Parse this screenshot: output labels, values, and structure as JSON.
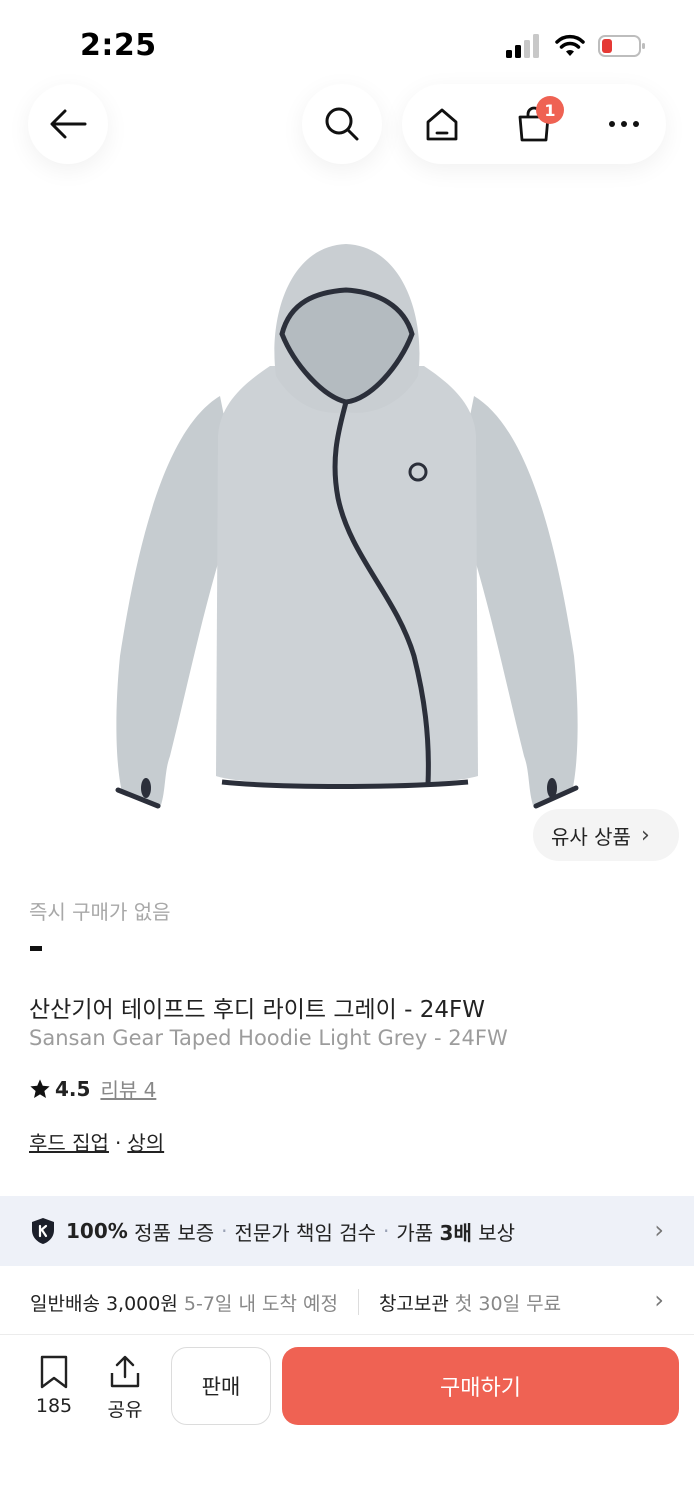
{
  "status_bar": {
    "time": "2:25",
    "icons": [
      "signal-icon",
      "wifi-icon",
      "battery-icon"
    ],
    "battery_color": "#e53935"
  },
  "nav": {
    "icons": [
      "back-arrow-icon",
      "search-icon",
      "home-icon",
      "cart-icon",
      "more-icon"
    ],
    "cart_count": "1"
  },
  "product": {
    "image": "hoodie-image",
    "similar_label": "유사 상품",
    "instant_status": "즉시 구매가 없음",
    "price": "-",
    "title_ko": "산산기어 테이프드 후디 라이트 그레이 - 24FW",
    "title_en": "Sansan Gear Taped Hoodie Light Grey - 24FW",
    "rating": "4.5",
    "review_label": "리뷰 4",
    "categories": [
      "후드 집업",
      "상의"
    ],
    "category_separator": "·"
  },
  "guarantee": {
    "part1_bold": "100%",
    "part1_text": "정품 보증",
    "part2": "전문가 책임 검수",
    "part3_a": "가품",
    "part3_bold": "3배",
    "part3_b": "보상",
    "separator": "·"
  },
  "delivery": {
    "standard_label": "일반배송 3,000원",
    "standard_eta": "5-7일 내 도착 예정",
    "storage_label": "창고보관",
    "storage_note": "첫 30일 무료"
  },
  "bottom_bar": {
    "bookmark_count": "185",
    "share_label": "공유",
    "sell_label": "판매",
    "buy_label": "구매하기",
    "accent_color": "#ef6253"
  }
}
